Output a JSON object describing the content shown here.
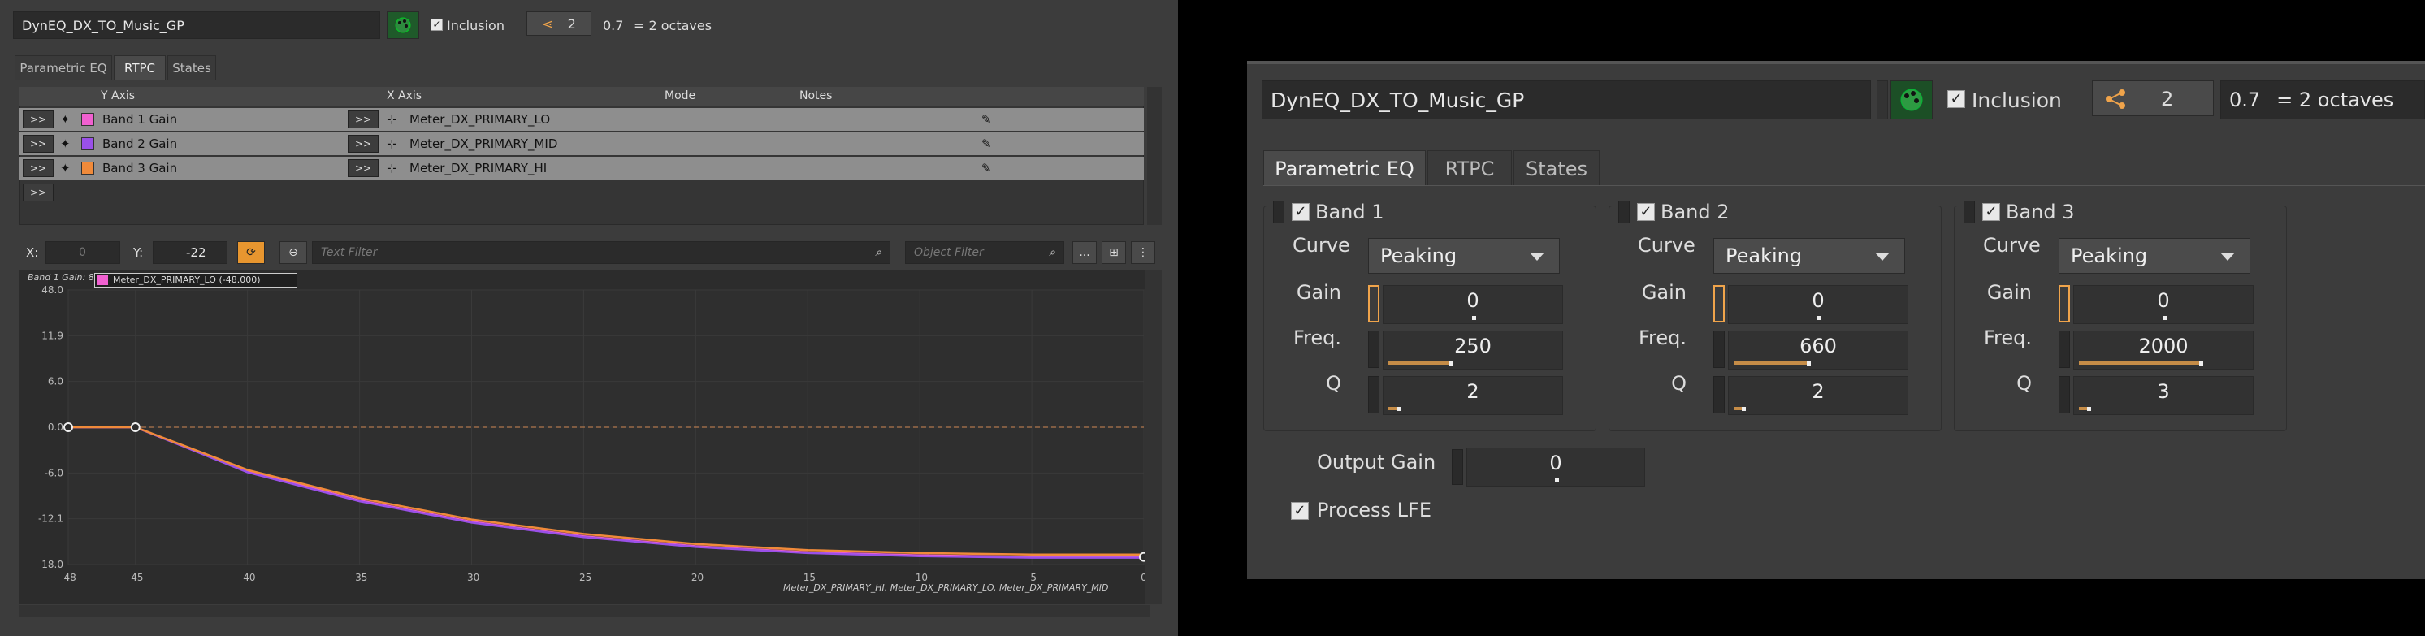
{
  "left": {
    "title": "DynEQ_DX_TO_Music_GP",
    "inclusion_label": "Inclusion",
    "share_count": "2",
    "octave_value": "0.7",
    "octave_label": "= 2 octaves",
    "tabs": [
      "Parametric EQ",
      "RTPC",
      "States"
    ],
    "columns": [
      "Y Axis",
      "X Axis",
      "Mode",
      "Notes"
    ],
    "rows": [
      {
        "y": "Band 1 Gain",
        "x": "Meter_DX_PRIMARY_LO",
        "color": "#f060d0"
      },
      {
        "y": "Band 2 Gain",
        "x": "Meter_DX_PRIMARY_MID",
        "color": "#9a50e8"
      },
      {
        "y": "Band 3 Gain",
        "x": "Meter_DX_PRIMARY_HI",
        "color": "#f08a3a"
      }
    ],
    "arrow_label": ">>",
    "x_label": "X:",
    "x_value": "0",
    "y_label": "Y:",
    "y_value": "-22",
    "text_filter_placeholder": "Text Filter",
    "object_filter_placeholder": "Object Filter",
    "more_label": "...",
    "graph_title": "Band 1 Gain: 8",
    "graph_tooltip": "Meter_DX_PRIMARY_LO (-48.000)",
    "graph_footer": "Meter_DX_PRIMARY_HI, Meter_DX_PRIMARY_LO, Meter_DX_PRIMARY_MID"
  },
  "right": {
    "title": "DynEQ_DX_TO_Music_GP",
    "inclusion_label": "Inclusion",
    "share_count": "2",
    "octave_value": "0.7",
    "octave_label": "= 2 octaves",
    "tabs": [
      "Parametric EQ",
      "RTPC",
      "States"
    ],
    "param_labels": {
      "curve": "Curve",
      "gain": "Gain",
      "freq": "Freq.",
      "q": "Q"
    },
    "bands": [
      {
        "name": "Band 1",
        "curve": "Peaking",
        "gain": "0",
        "freq": "250",
        "q": "2"
      },
      {
        "name": "Band 2",
        "curve": "Peaking",
        "gain": "0",
        "freq": "660",
        "q": "2"
      },
      {
        "name": "Band 3",
        "curve": "Peaking",
        "gain": "0",
        "freq": "2000",
        "q": "3"
      }
    ],
    "output_gain_label": "Output Gain",
    "output_gain_value": "0",
    "process_lfe_label": "Process LFE"
  },
  "chart_data": {
    "type": "line",
    "x_ticks": [
      "-48",
      "-45",
      "-40",
      "-35",
      "-30",
      "-25",
      "-20",
      "-15",
      "-10",
      "-5",
      "0"
    ],
    "y_ticks": [
      "48.0",
      "11.9",
      "6.0",
      "0.0",
      "-6.0",
      "-12.1",
      "-18.0"
    ],
    "xlim": [
      -48,
      0
    ],
    "series": [
      {
        "name": "Band 1 Gain",
        "color": "#f060d0",
        "x": [
          -48,
          -45,
          -40,
          -35,
          -30,
          -25,
          -20,
          -15,
          -10,
          -5,
          0
        ],
        "y": [
          0,
          0,
          -5.8,
          -9.6,
          -12.4,
          -14.3,
          -15.6,
          -16.4,
          -16.8,
          -17.0,
          -17.0
        ]
      },
      {
        "name": "Band 2 Gain",
        "color": "#9a50e8",
        "x": [
          -48,
          -45,
          -40,
          -35,
          -30,
          -25,
          -20,
          -15,
          -10,
          -5,
          0
        ],
        "y": [
          0,
          0,
          -5.9,
          -9.7,
          -12.5,
          -14.4,
          -15.7,
          -16.5,
          -16.9,
          -17.1,
          -17.1
        ]
      },
      {
        "name": "Band 3 Gain",
        "color": "#f08a3a",
        "x": [
          -48,
          -45,
          -40,
          -35,
          -30,
          -25,
          -20,
          -15,
          -10,
          -5,
          0
        ],
        "y": [
          0,
          0,
          -5.6,
          -9.3,
          -12.1,
          -14.0,
          -15.3,
          -16.1,
          -16.5,
          -16.7,
          -16.7
        ]
      }
    ]
  }
}
